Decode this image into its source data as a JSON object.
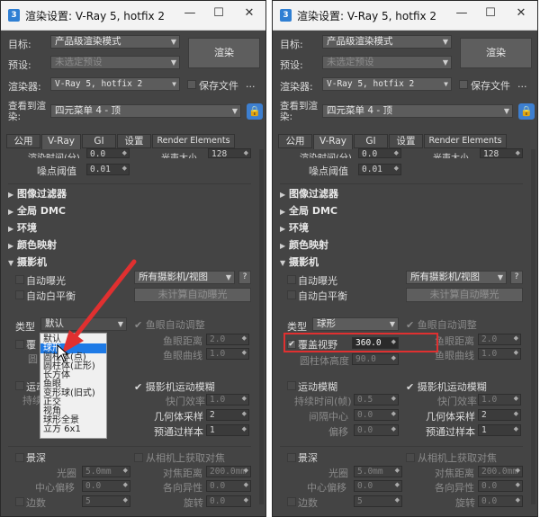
{
  "window": {
    "title": "渲染设置: V-Ray 5, hotfix 2",
    "minimize": "—",
    "maximize": "☐",
    "close": "✕"
  },
  "top": {
    "target_label": "目标:",
    "target_value": "产品级渲染模式",
    "preset_label": "预设:",
    "preset_value": "未选定预设",
    "renderer_label": "渲染器:",
    "renderer_value": "V-Ray 5, hotfix 2",
    "render_button": "渲染",
    "save_file_label": "保存文件",
    "more": "...",
    "view_label_1": "查看到渲",
    "view_label_2": "染:",
    "view_value": "四元菜单 4 - 顶"
  },
  "tabs": [
    "公用",
    "V-Ray",
    "GI",
    "设置",
    "Render Elements"
  ],
  "cutoff": {
    "time_label": "渲染时间(分)",
    "time_value": "0.0",
    "light_size_label": "光束大小",
    "light_size_value": "128",
    "noise_label": "噪点阈值",
    "noise_value": "0.01"
  },
  "sections": [
    "图像过滤器",
    "全局 DMC",
    "环境",
    "颜色映射",
    "摄影机"
  ],
  "camera": {
    "auto_exposure": "自动曝光",
    "auto_wb": "自动白平衡",
    "all_cameras": "所有摄影机/视图",
    "help": "?",
    "calc_exposure": "未计算自动曝光",
    "type_label": "类型",
    "type_value_left": "默认",
    "type_value_right": "球形",
    "fisheye_auto": "鱼眼自动调整",
    "fisheye_dist_label": "鱼眼距离",
    "fisheye_dist_value": "2.0",
    "fisheye_curve_label": "鱼眼曲线",
    "fisheye_curve_value": "1.0",
    "fov_label": "覆盖视野",
    "fov_value": "360.0",
    "cyl_height_label": "圆柱体高度",
    "cyl_height_value": "90.0",
    "motion_blur": "运动模糊",
    "camera_motion_blur": "摄影机运动模糊",
    "duration_label": "持续时间(帧)",
    "duration_value": "0.5",
    "shutter_label": "快门效率",
    "shutter_value": "1.0",
    "interval_label": "间隔中心",
    "interval_value": "0.0",
    "geo_samples_label": "几何体采样",
    "geo_samples_value": "2",
    "bias_label": "偏移",
    "bias_value": "0.0",
    "prepass_label": "预通过样本",
    "prepass_value": "1",
    "dof": "景深",
    "from_camera": "从相机上获取对焦",
    "aperture_label": "光圈",
    "aperture_value": "5.0mm",
    "focus_dist_label": "对焦距离",
    "focus_dist_value": "200.0mm",
    "center_bias_label": "中心偏移",
    "center_bias_value": "0.0",
    "anisotropy_label": "各向异性",
    "anisotropy_value": "0.0",
    "sides_label": "边数",
    "sides_value": "5",
    "rotation_label": "旋转",
    "rotation_value": "0.0"
  },
  "left_partial": {
    "cover_trunc": "覆",
    "cyl_trunc": "圆",
    "motion_trunc": "运动",
    "duration_trunc": "持续",
    "interval_trunc": "间",
    "ok_trunc": "立方 6x1"
  },
  "type_menu": [
    "默认",
    "球形",
    "圆柱体(点)",
    "圆柱体(正形)",
    "长方体",
    "鱼眼",
    "变形球(旧式)",
    "正交",
    "视角",
    "球形全景",
    "立方 6x1"
  ],
  "colors": {
    "accent": "#1e7ae6",
    "highlight": "#e03030",
    "panel": "#444444"
  }
}
